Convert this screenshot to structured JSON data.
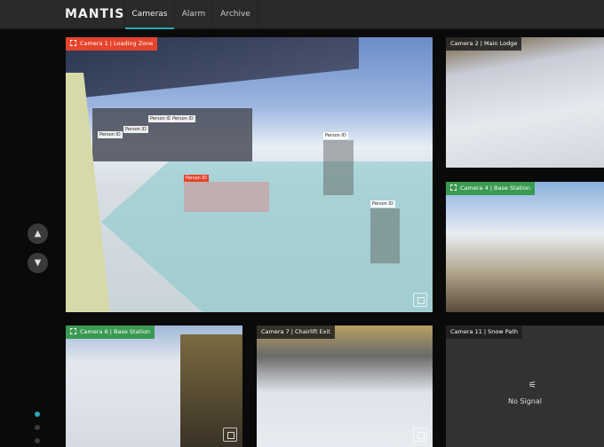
{
  "header": {
    "logo": "MANTIS",
    "tabs": [
      {
        "label": "Cameras",
        "active": true
      },
      {
        "label": "Alarm"
      },
      {
        "label": "Archive"
      }
    ],
    "accent": "#2aa6b8"
  },
  "cameras": [
    {
      "label": "Camera 1 | Loading Zone",
      "status": "alert",
      "color": "#e5432b",
      "detections": [
        "Person ID",
        "Person ID",
        "Person ID",
        "Person ID",
        "Person ID",
        "Person ID",
        "Person ID"
      ]
    },
    {
      "label": "Camera 2 | Main Lodge"
    },
    {
      "label": "Camera 4 | Base Station",
      "status": "ok",
      "color": "#3a9a52"
    },
    {
      "label": "Camera 6 | Base Station",
      "status": "ok",
      "color": "#3a9a52"
    },
    {
      "label": "Camera 7 | Chairlift Exit"
    },
    {
      "label": "Camera 11 | Snow Path",
      "message": "No Signal"
    }
  ],
  "nav": {
    "up": "▲",
    "down": "▼",
    "page": 1,
    "pages": 3
  }
}
